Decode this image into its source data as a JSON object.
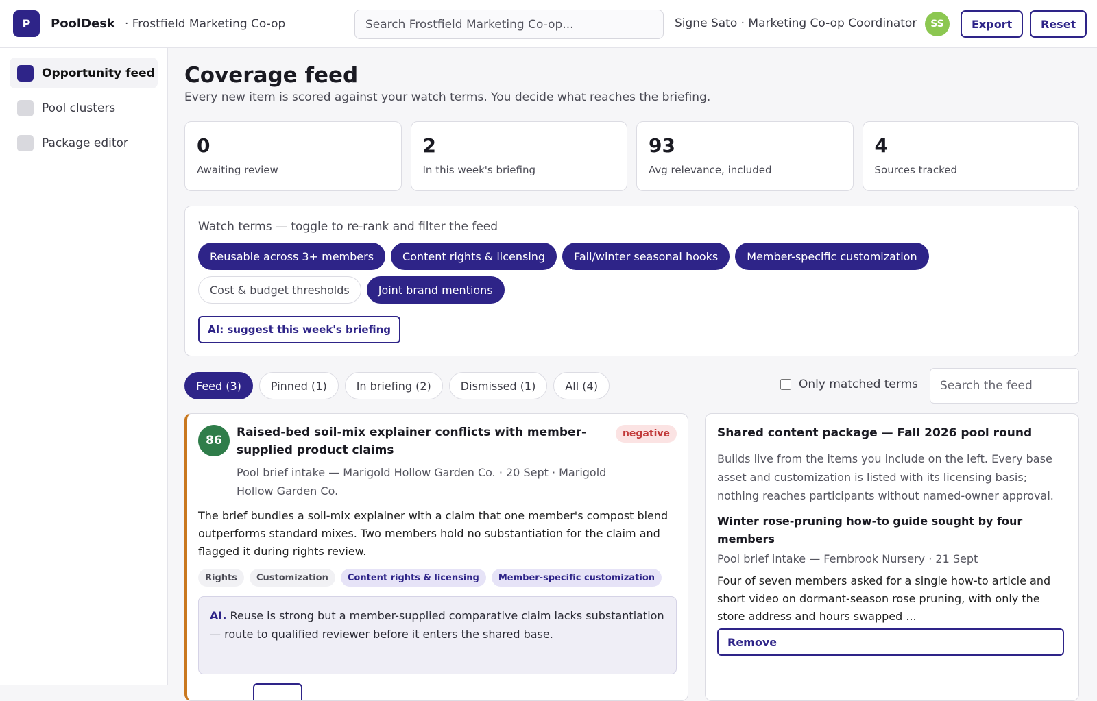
{
  "header": {
    "logo_letter": "P",
    "brand": "PoolDesk",
    "org": "· Frostfield Marketing Co-op",
    "search_placeholder": "Search Frostfield Marketing Co-op...",
    "user": "Signe Sato · Marketing Co-op Coordinator",
    "avatar_initials": "SS",
    "export_label": "Export",
    "reset_label": "Reset"
  },
  "sidebar": {
    "items": [
      {
        "label": "Opportunity feed",
        "active": true
      },
      {
        "label": "Pool clusters",
        "active": false
      },
      {
        "label": "Package editor",
        "active": false
      }
    ]
  },
  "main": {
    "title": "Coverage feed",
    "subtitle": "Every new item is scored against your watch terms. You decide what reaches the briefing.",
    "stats": [
      {
        "value": "0",
        "label": "Awaiting review"
      },
      {
        "value": "2",
        "label": "In this week's briefing"
      },
      {
        "value": "93",
        "label": "Avg relevance, included"
      },
      {
        "value": "4",
        "label": "Sources tracked"
      }
    ],
    "watch": {
      "title": "Watch terms — toggle to re-rank and filter the feed",
      "terms": [
        {
          "label": "Reusable across 3+ members",
          "on": true
        },
        {
          "label": "Content rights & licensing",
          "on": true
        },
        {
          "label": "Fall/winter seasonal hooks",
          "on": true
        },
        {
          "label": "Member-specific customization",
          "on": true
        },
        {
          "label": "Cost & budget thresholds",
          "on": false
        },
        {
          "label": "Joint brand mentions",
          "on": true
        }
      ],
      "ai_button": "AI: suggest this week's briefing"
    },
    "tabs": [
      {
        "label": "Feed (3)",
        "on": true
      },
      {
        "label": "Pinned (1)",
        "on": false
      },
      {
        "label": "In briefing (2)",
        "on": false
      },
      {
        "label": "Dismissed (1)",
        "on": false
      },
      {
        "label": "All (4)",
        "on": false
      }
    ],
    "only_matched_label": "Only matched terms",
    "feed_search_placeholder": "Search the feed"
  },
  "card": {
    "score": "86",
    "title": "Raised-bed soil-mix explainer conflicts with member-supplied product claims",
    "sentiment": "negative",
    "meta": "Pool brief intake — Marigold Hollow Garden Co. · 20 Sept · Marigold Hollow Garden Co.",
    "body": "The brief bundles a soil-mix explainer with a claim that one member's compost blend outperforms standard mixes. Two members hold no substantiation for the claim and flagged it during rights review.",
    "tags": [
      {
        "label": "Rights",
        "match": false
      },
      {
        "label": "Customization",
        "match": false
      },
      {
        "label": "Content rights & licensing",
        "match": true
      },
      {
        "label": "Member-specific customization",
        "match": true
      }
    ],
    "ai_label": "AI.",
    "ai_text": "Reuse is strong but a member-supplied comparative claim lacks substantiation — route to qualified reviewer before it enters the shared base."
  },
  "package": {
    "title": "Shared content package — Fall 2026 pool round",
    "desc": "Builds live from the items you include on the left. Every base asset and customization is listed with its licensing basis; nothing reaches participants without named-owner approval.",
    "item_title": "Winter rose-pruning how-to guide sought by four members",
    "item_meta": "Pool brief intake — Fernbrook Nursery · 21 Sept",
    "item_body": "Four of seven members asked for a single how-to article and short video on dormant-season rose pruning, with only the store address and hours swapped ...",
    "remove_label": "Remove"
  },
  "colors": {
    "accent": "#2e2488",
    "score_bg": "#2f7d4a",
    "card_border": "#c9781f",
    "avatar_bg": "#8cc751",
    "negative": "#c23a3a"
  }
}
